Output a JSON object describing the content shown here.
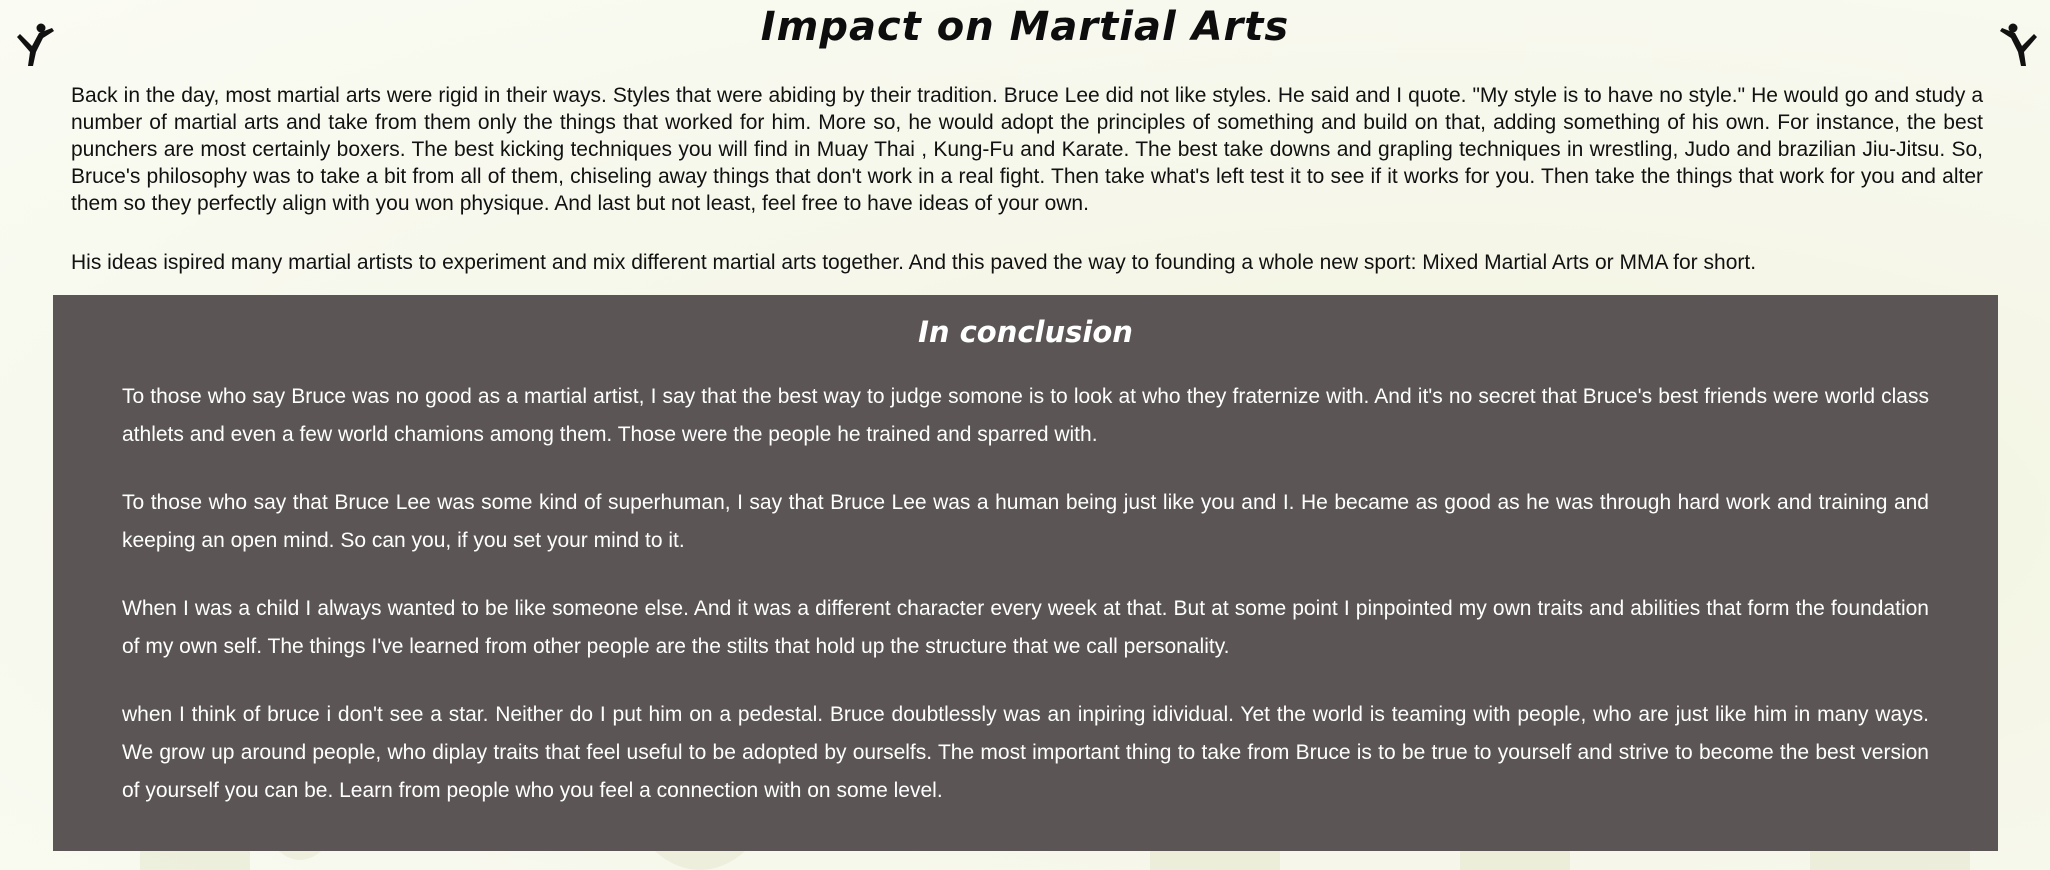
{
  "header": {
    "title": "Impact on Martial Arts",
    "left_icon": "karate-kick-icon",
    "right_icon": "karate-kick-icon"
  },
  "intro": {
    "paragraphs": [
      "Back in the day, most martial arts were rigid in their ways. Styles that were abiding by their tradition. Bruce Lee did not like styles. He said and I quote. \"My style is to have no style.\" He would go and study a number of martial arts and take from them only the things that worked for him. More so, he would adopt the principles of something and build on that, adding something of his own. For instance, the best punchers are most certainly boxers. The best kicking techniques you will find in Muay Thai , Kung-Fu and Karate. The best take downs and grapling techniques in wrestling, Judo and brazilian Jiu-Jitsu. So, Bruce's philosophy was to take a bit from all of them, chiseling away things that don't work in a real fight. Then take what's left test it to see if it works for you. Then take the things that work for you and alter them so they perfectly align with you won physique. And last but not least, feel free to have ideas of your own.",
      "His ideas ispired many martial artists to experiment and mix different martial arts together. And this paved the way to founding a whole new sport: Mixed Martial Arts or MMA for short."
    ]
  },
  "conclusion": {
    "title": "In conclusion",
    "paragraphs": [
      "To those who say Bruce was no good as a martial artist, I say that the best way to judge somone is to look at who they fraternize with. And it's no secret that Bruce's best friends were world class athlets and even a few world chamions among them. Those were the people he trained and sparred with.",
      "To those who say that Bruce Lee was some kind of superhuman, I say that Bruce Lee was a human being just like you and I. He became as good as he was through hard work and training and keeping an open mind. So can you, if you set your mind to it.",
      "When I was a child I always wanted to be like someone else. And it was a different character every week at that. But at some point I pinpointed my own traits and abilities that form the foundation of my own self. The things I've learned from other people are the stilts that hold up the structure that we call personality.",
      "when I think of bruce i don't see a star. Neither do I put him on a pedestal. Bruce doubtlessly was an inpiring idividual. Yet the world is teaming with people, who are just like him in many ways. We grow up around people, who diplay traits that feel useful to be adopted by ourselfs. The most important thing to take from Bruce is to be true to yourself and strive to become the best version of yourself you can be. Learn from people who you feel a connection with on some level."
    ]
  },
  "colors": {
    "background": "#f6f7ea",
    "conclusion_panel": "#5b5655",
    "text_dark": "#111111",
    "text_light": "#ffffff"
  }
}
